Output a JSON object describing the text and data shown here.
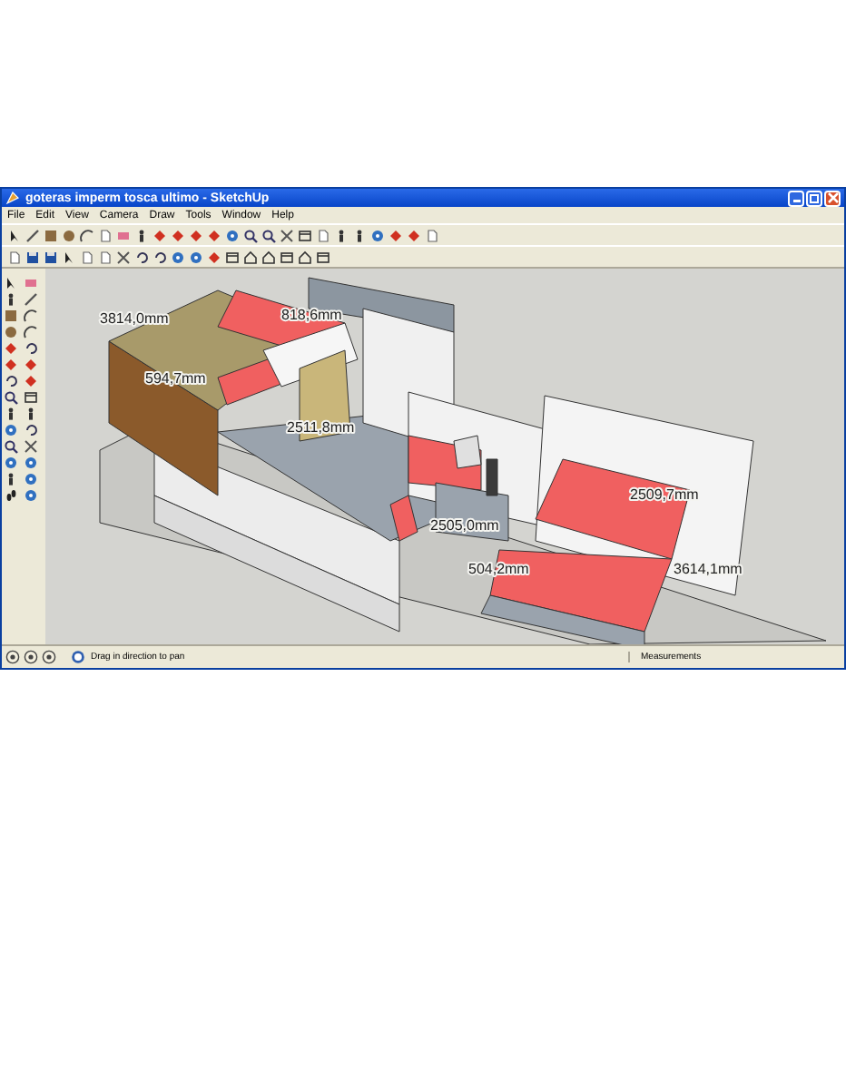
{
  "window": {
    "title": "goteras imperm tosca ultimo - SketchUp"
  },
  "menu": [
    "File",
    "Edit",
    "View",
    "Camera",
    "Draw",
    "Tools",
    "Window",
    "Help"
  ],
  "viewport": {
    "dimension_labels": [
      "3814,0mm",
      "818,6mm",
      "594,7mm",
      "2511,8mm",
      "2505,0mm",
      "504,2mm",
      "2509,7mm",
      "3614,1mm"
    ]
  },
  "status_bar": {
    "hint": "Drag in direction to pan",
    "measurements_label": "Measurements"
  }
}
